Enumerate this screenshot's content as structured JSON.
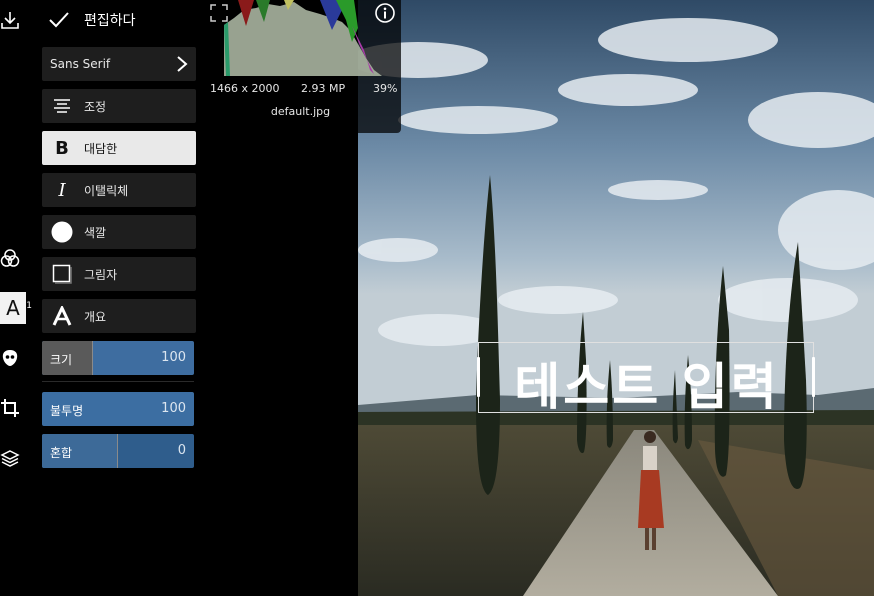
{
  "panel": {
    "done_label": "편집하다",
    "font_name": "Sans Serif",
    "rows": {
      "adjust": "조정",
      "bold": "대담한",
      "italic": "이탤릭체",
      "color": "색깔",
      "shadow": "그림자",
      "outline": "개요"
    },
    "sliders": {
      "size": {
        "label": "크기",
        "value": "100"
      },
      "opacity": {
        "label": "불투명",
        "value": "100"
      },
      "blend": {
        "label": "혼합",
        "value": "0"
      }
    }
  },
  "toolbar": {
    "text_tool_badge": "1",
    "text_tool_glyph": "A"
  },
  "image_info": {
    "dimensions": "1466 x 2000",
    "megapixels": "2.93 MP",
    "zoom": "39%",
    "filename": "default.jpg"
  },
  "overlay_text": "테스트 입력",
  "colors": {
    "panel_bg": "#000000",
    "row_bg": "#1e1e1e",
    "slider_blue": "#3e6da0",
    "active_row": "#e9e9e9"
  }
}
